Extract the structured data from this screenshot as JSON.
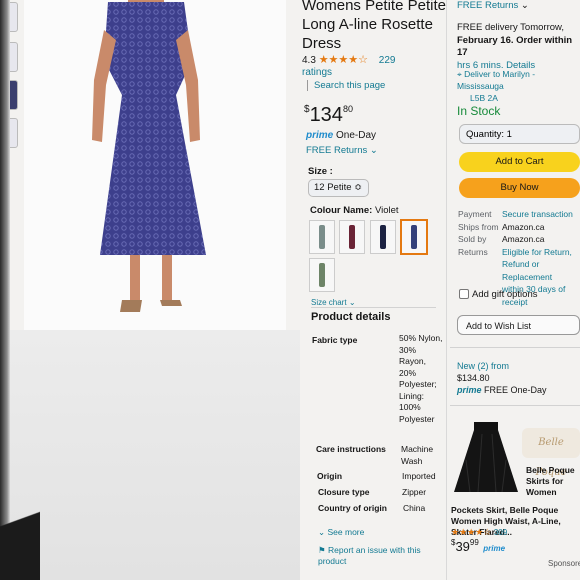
{
  "product": {
    "title": "Womens Petite Petite Long A-line Rosette Dress",
    "rating_value": "4.3",
    "stars": "★★★★☆",
    "rating_count": "229",
    "ratings_label": "ratings",
    "search_page": "Search this page",
    "price_symbol": "$",
    "price_main": "134",
    "price_cents": "80",
    "prime_label": "prime",
    "prime_delivery": "One-Day",
    "free_returns": "FREE Returns",
    "size_label": "Size :",
    "size_value": "12 Petite",
    "color_label": "Colour Name:",
    "color_value": "Violet",
    "swatches": [
      {
        "color": "#7a8d8a"
      },
      {
        "color": "#6a2436"
      },
      {
        "color": "#1c2242"
      },
      {
        "color": "#33407a"
      },
      {
        "color": "#6d8468"
      }
    ],
    "size_chart": "Size chart"
  },
  "details": {
    "title": "Product details",
    "rows": [
      {
        "key": "Fabric type",
        "value": "50% Nylon, 30% Rayon, 20% Polyester; Lining: 100% Polyester"
      },
      {
        "key": "Care instructions",
        "value": "Machine Wash"
      },
      {
        "key": "Origin",
        "value": "Imported"
      },
      {
        "key": "Closure type",
        "value": "Zipper"
      },
      {
        "key": "Country of origin",
        "value": "China"
      }
    ],
    "see_more": "See more",
    "report": "Report an issue with this product"
  },
  "buybox": {
    "free_returns": "FREE Returns",
    "delivery_line1": "FREE delivery Tomorrow,",
    "delivery_line2": "February 16. Order within 17",
    "delivery_line3": "hrs 6 mins. Details",
    "deliver_to": "Deliver to Marilyn - Mississauga",
    "postal": "L5B 2A",
    "in_stock": "In Stock",
    "quantity": "Quantity: 1",
    "add_to_cart": "Add to Cart",
    "buy_now": "Buy Now",
    "payment_k": "Payment",
    "payment_v": "Secure transaction",
    "ships_k": "Ships from",
    "ships_v": "Amazon.ca",
    "sold_k": "Sold by",
    "sold_v": "Amazon.ca",
    "returns_k": "Returns",
    "returns_v1": "Eligible for Return,",
    "returns_v2": "Refund or Replacement",
    "returns_v3": "within 30 days of receipt",
    "gift": "Add gift options",
    "wish": "Add to Wish List",
    "new_from": "New (2) from",
    "new_price": "$134.80",
    "new_prime": "prime",
    "new_delivery": "FREE One-Day"
  },
  "ad": {
    "logo": "Belle Poque",
    "brand": "Belle Poque Skirts for Women",
    "desc": "Pockets Skirt, Belle Poque Women High Waist, A-Line, Skater Flared...",
    "stars": "★★★★☆",
    "count": "309",
    "price_main": "39",
    "price_cents": "99",
    "prime": "prime",
    "sponsored": "Sponsored"
  },
  "icons": {
    "location": "location-pin-icon",
    "report": "report-flag-icon"
  }
}
